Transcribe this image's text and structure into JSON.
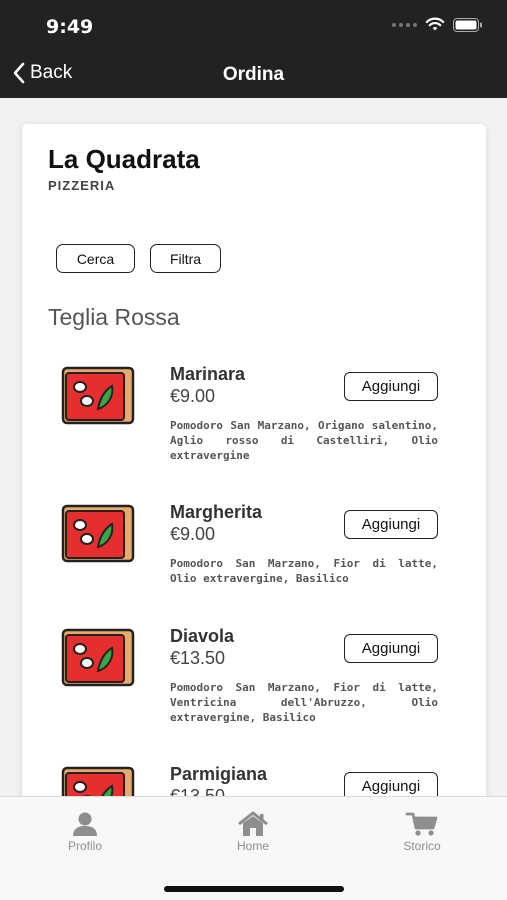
{
  "status": {
    "time": "9:49"
  },
  "nav": {
    "back_label": "Back",
    "title": "Ordina"
  },
  "restaurant": {
    "name": "La Quadrata",
    "type": "PIZZERIA"
  },
  "filters": {
    "search_label": "Cerca",
    "filter_label": "Filtra"
  },
  "section": {
    "title": "Teglia Rossa"
  },
  "items": [
    {
      "name": "Marinara",
      "price": "€9.00",
      "description": "Pomodoro San Marzano, Origano salentino, Aglio rosso di Castelliri, Olio extravergine",
      "button": "Aggiungi",
      "icon": "pizza-slice-icon"
    },
    {
      "name": "Margherita",
      "price": "€9.00",
      "description": "Pomodoro San Marzano, Fior di latte, Olio extravergine, Basilico",
      "button": "Aggiungi",
      "icon": "pizza-slice-icon"
    },
    {
      "name": "Diavola",
      "price": "€13.50",
      "description": "Pomodoro San Marzano, Fior di latte, Ventricina dell'Abruzzo, Olio extravergine, Basilico",
      "button": "Aggiungi",
      "icon": "pizza-slice-icon"
    },
    {
      "name": "Parmigiana",
      "price": "€13.50",
      "description": "",
      "button": "Aggiungi",
      "icon": "pizza-slice-icon"
    }
  ],
  "tabs": [
    {
      "label": "Profilo",
      "icon": "person-icon"
    },
    {
      "label": "Home",
      "icon": "house-icon"
    },
    {
      "label": "Storico",
      "icon": "cart-icon"
    }
  ],
  "colors": {
    "header_bg": "#222222",
    "pizza_red": "#e62e2e",
    "pizza_crust": "#e8a96a",
    "basil": "#3aa548"
  }
}
